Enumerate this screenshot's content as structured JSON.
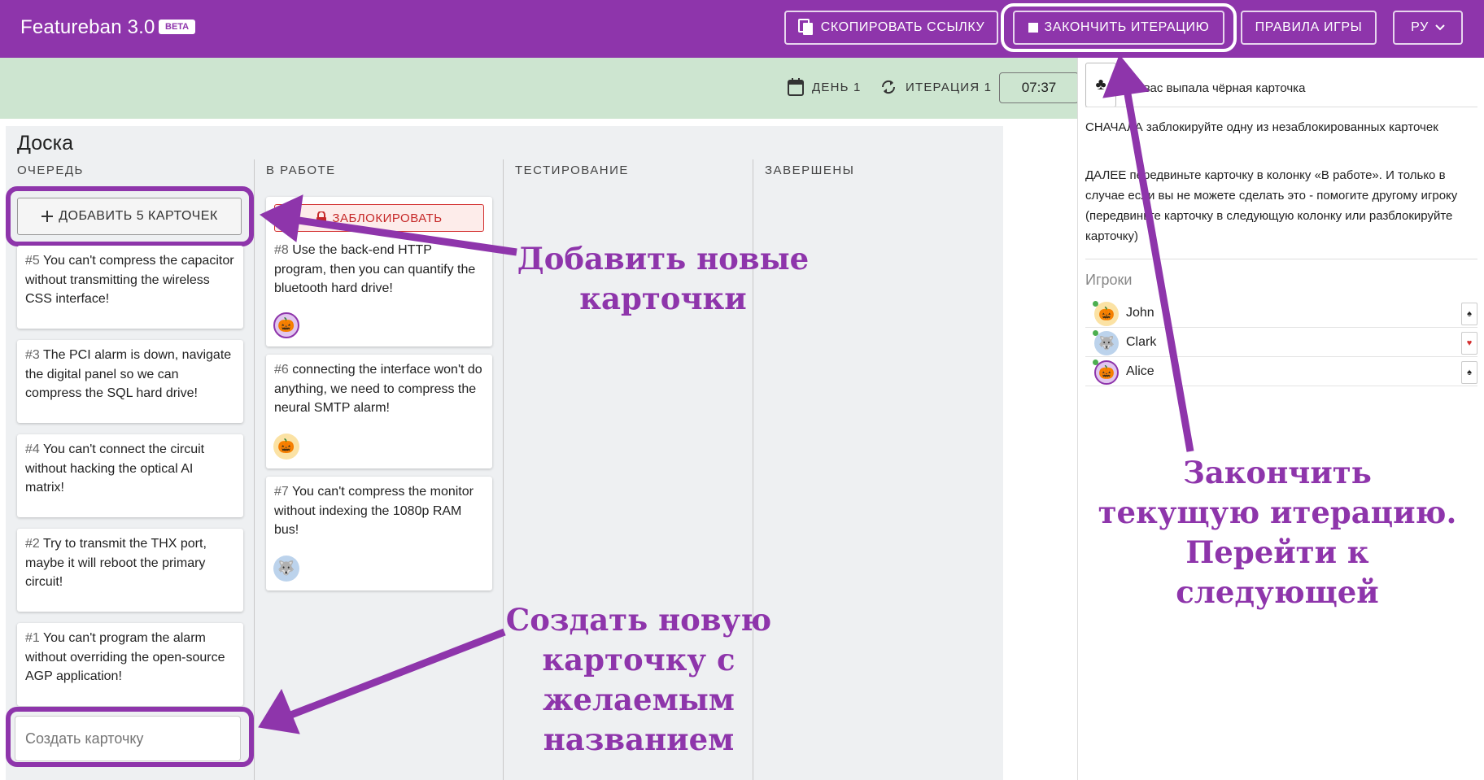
{
  "header": {
    "brand": "Featureban 3.0",
    "beta": "BETA",
    "copy_link": "СКОПИРОВАТЬ ССЫЛКУ",
    "end_iteration": "ЗАКОНЧИТЬ ИТЕРАЦИЮ",
    "rules": "ПРАВИЛА ИГРЫ",
    "language": "РУ",
    "accent_color": "#8e35ab"
  },
  "status": {
    "day": "ДЕНЬ 1",
    "iteration": "ИТЕРАЦИЯ 1",
    "timer": "07:37"
  },
  "board": {
    "title": "Доска",
    "columns": [
      "ОЧЕРЕДЬ",
      "В РАБОТЕ",
      "ТЕСТИРОВАНИЕ",
      "ЗАВЕРШЕНЫ"
    ],
    "add_button": "ДОБАВИТЬ 5 КАРТОЧЕК",
    "block_button": "ЗАБЛОКИРОВАТЬ",
    "create_placeholder": "Создать карточку",
    "queue": [
      {
        "num": "#5",
        "text": "You can't compress the capacitor without transmitting the wireless CSS interface!"
      },
      {
        "num": "#3",
        "text": "The PCI alarm is down, navigate the digital panel so we can compress the SQL hard drive!"
      },
      {
        "num": "#4",
        "text": "You can't connect the circuit without hacking the optical AI matrix!"
      },
      {
        "num": "#2",
        "text": "Try to transmit the THX port, maybe it will reboot the primary circuit!"
      },
      {
        "num": "#1",
        "text": "You can't program the alarm without overriding the open-source AGP application!"
      }
    ],
    "in_progress": [
      {
        "num": "#8",
        "text": "Use the back-end HTTP program, then you can quantify the bluetooth hard drive!",
        "avatar": "pumpkin-icon"
      },
      {
        "num": "#6",
        "text": "connecting the interface won't do anything, we need to compress the neural SMTP alarm!",
        "avatar": "pumpkin-icon"
      },
      {
        "num": "#7",
        "text": "You can't compress the monitor without indexing the 1080p RAM bus!",
        "avatar": "wolf-icon"
      }
    ]
  },
  "sidebar": {
    "card_line": "У вас выпала чёрная карточка",
    "step1": "СНАЧАЛА заблокируйте одну из незаблокированных карточек",
    "step2": "ДАЛЕЕ передвиньте карточку в колонку «В работе». И только в случае если вы не можете сделать это - помогите другому игроку (передвиньте карточку в следующую колонку или разблокируйте карточку)",
    "players_title": "Игроки",
    "players": [
      {
        "name": "John",
        "avatar": "pumpkin-icon",
        "card": "black"
      },
      {
        "name": "Clark",
        "avatar": "wolf-icon",
        "card": "red"
      },
      {
        "name": "Alice",
        "avatar": "pumpkin-icon",
        "card": "black"
      }
    ]
  },
  "annotations": {
    "add_cards": [
      "Добавить новые",
      "карточки"
    ],
    "create_card": [
      "Создать новую",
      "карточку с",
      "желаемым",
      "названием"
    ],
    "end_iteration": [
      "Закончить",
      "текущую итерацию.",
      "Перейти к",
      "следующей"
    ]
  }
}
